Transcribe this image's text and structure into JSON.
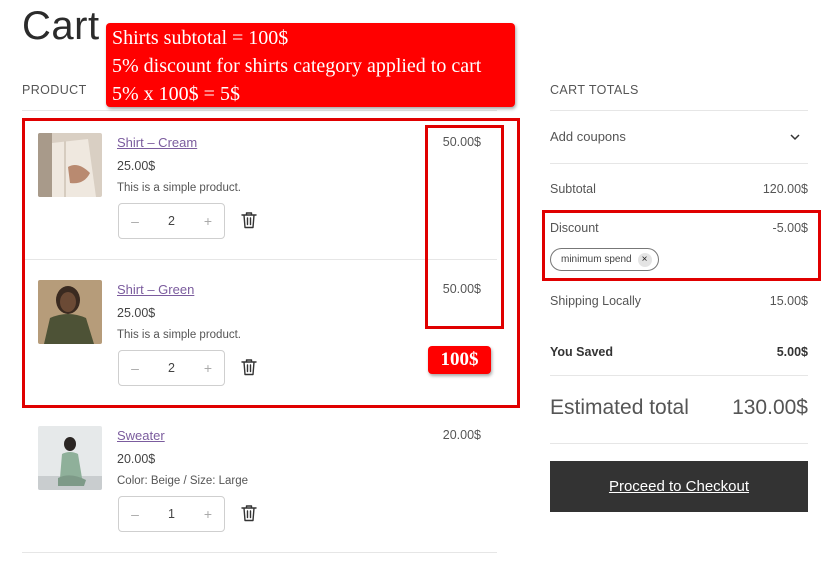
{
  "page": {
    "title": "Cart"
  },
  "headers": {
    "product": "PRODUCT",
    "totals": "CART TOTALS"
  },
  "annotation": {
    "lines": [
      "Shirts subtotal = 100$",
      "5% discount for shirts category applied to cart",
      "5% x 100$ = 5$"
    ],
    "sum_label": "100$",
    "color": "#ff0000"
  },
  "items": [
    {
      "name": "Shirt – Cream",
      "unit_price": "25.00$",
      "description": "This is a simple product.",
      "quantity": "2",
      "total": "50.00$",
      "minus": "–",
      "plus": "+"
    },
    {
      "name": "Shirt – Green",
      "unit_price": "25.00$",
      "description": "This is a simple product.",
      "quantity": "2",
      "total": "50.00$",
      "minus": "–",
      "plus": "+"
    },
    {
      "name": "Sweater",
      "unit_price": "20.00$",
      "description": "Color: Beige / Size: Large",
      "quantity": "1",
      "total": "20.00$",
      "minus": "–",
      "plus": "+"
    }
  ],
  "totals": {
    "add_coupons": "Add coupons",
    "subtotal_label": "Subtotal",
    "subtotal_value": "120.00$",
    "discount_label": "Discount",
    "discount_value": "-5.00$",
    "coupon_code": "minimum spend",
    "coupon_remove": "×",
    "shipping_label": "Shipping Locally",
    "shipping_value": "15.00$",
    "saved_label": "You Saved",
    "saved_value": "5.00$",
    "estimated_label": "Estimated total",
    "estimated_value": "130.00$",
    "checkout_label": "Proceed to Checkout"
  },
  "icons": {
    "trash": "trash-icon",
    "chevron": "chevron-down-icon",
    "close": "close-icon"
  },
  "colors": {
    "accent_link": "#7b5c9e",
    "checkout_bg": "#333333",
    "highlight": "#e00000"
  }
}
